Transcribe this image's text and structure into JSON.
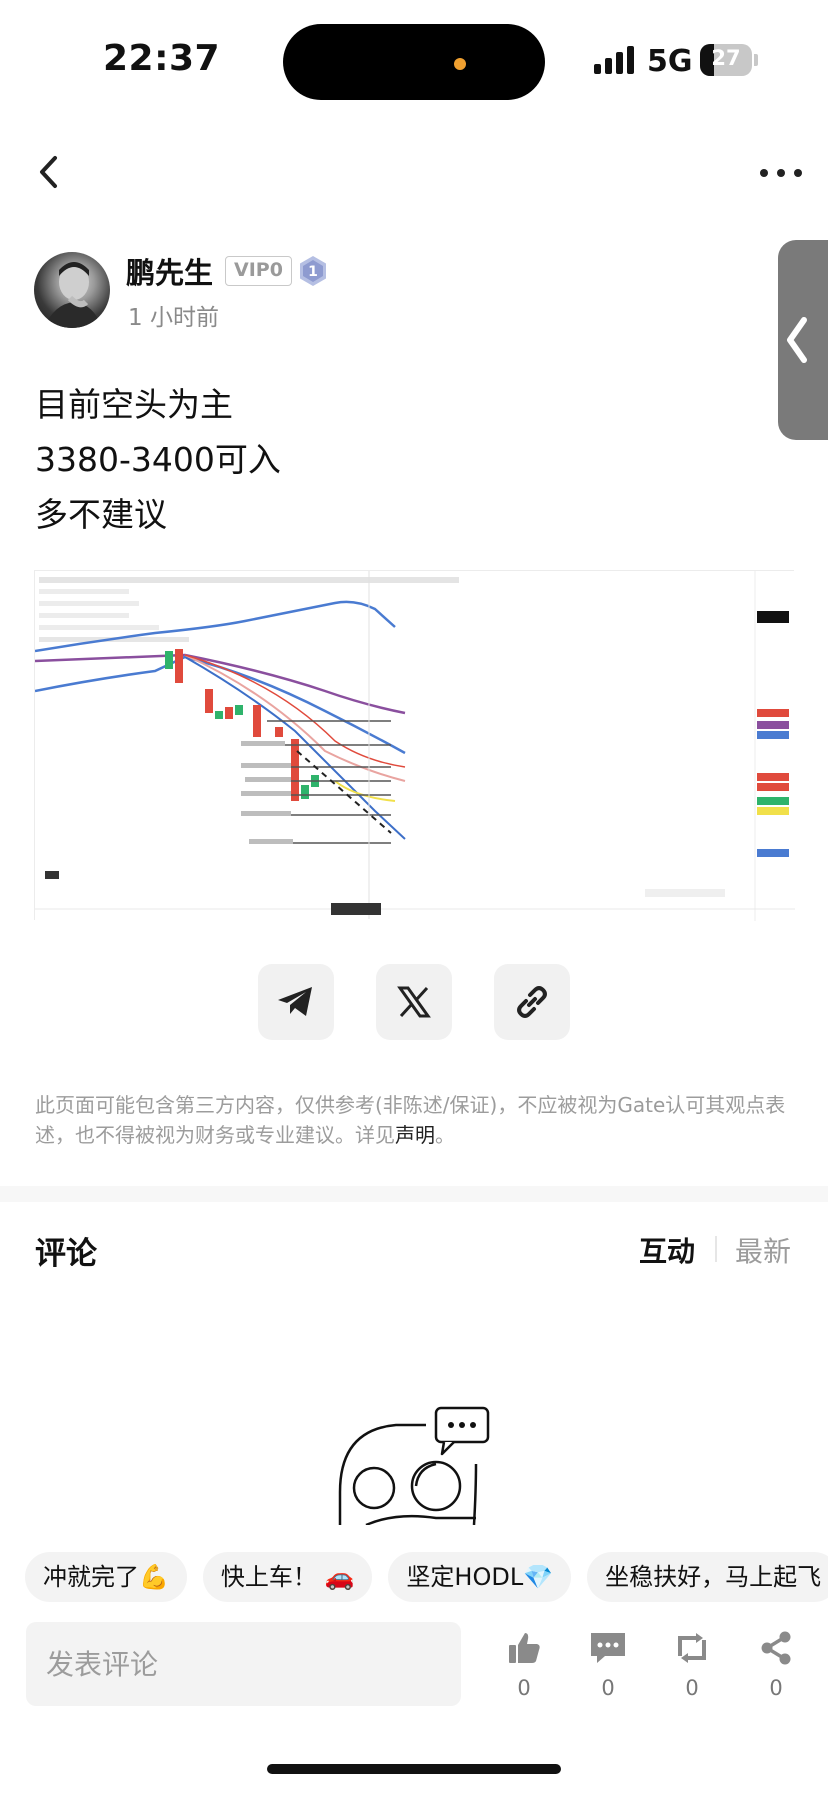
{
  "status_bar": {
    "time": "22:37",
    "network": "5G",
    "battery_level": "27",
    "battery_fraction": 0.27
  },
  "nav": {
    "back_icon": "chevron-left-icon",
    "more_icon": "more-horizontal-icon",
    "side_drawer_icon": "chevron-left-icon"
  },
  "author": {
    "name": "鹏先生",
    "vip_badge": "VIP0",
    "level": "1",
    "time_ago": "1 小时前"
  },
  "post": {
    "lines": [
      "目前空头为主",
      "3380-3400可入",
      "多不建议"
    ]
  },
  "chart_image": {
    "alt_icon": "trading-chart-image",
    "colors": {
      "bear_candle": "#e04a3c",
      "bull_candle": "#2fb36b",
      "band_blue": "#4a7bd1",
      "band_purple": "#8a4f9e"
    }
  },
  "share": {
    "telegram_icon": "telegram-icon",
    "x_icon": "x-logo-icon",
    "link_icon": "link-icon"
  },
  "disclaimer": {
    "text": "此页面可能包含第三方内容，仅供参考(非陈述/保证)，不应被视为Gate认可其观点表述，也不得被视为财务或专业建议。详见",
    "link": "声明",
    "end": "。"
  },
  "comments": {
    "title": "评论",
    "sort_active": "互动",
    "sort_inactive": "最新",
    "empty_icon": "empty-comments-illustration"
  },
  "quick_replies": [
    "冲就完了💪",
    "快上车！ 🚗",
    "坚定HODL💎",
    "坐稳扶好，马上起飞"
  ],
  "bottom_bar": {
    "input_placeholder": "发表评论",
    "like_count": "0",
    "comment_count": "0",
    "repost_count": "0",
    "share_count": "0"
  }
}
